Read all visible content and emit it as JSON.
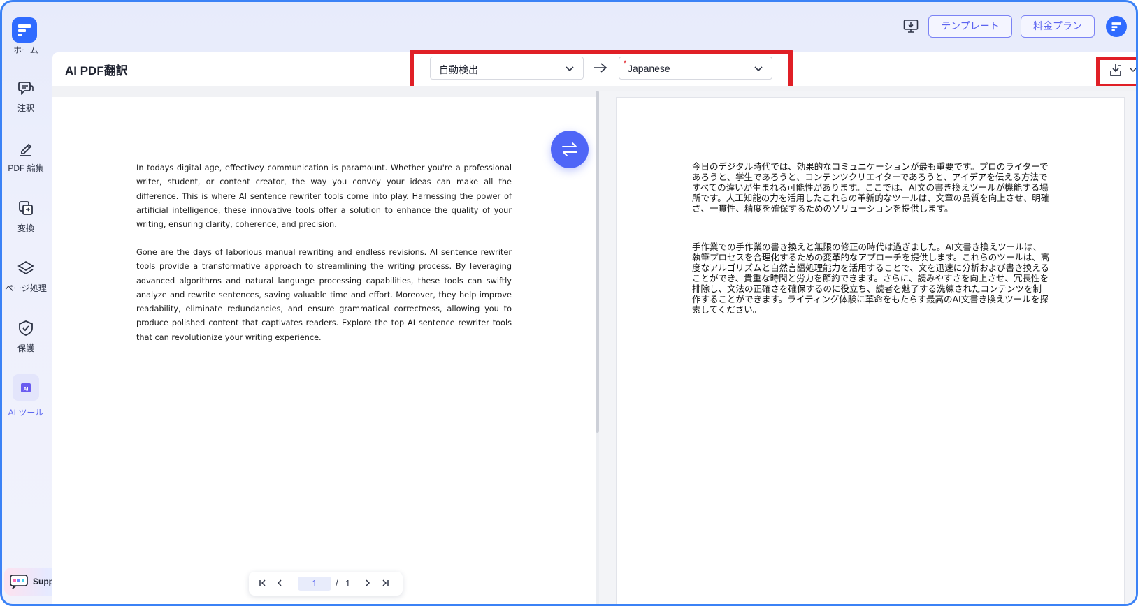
{
  "sidebar": {
    "home_label": "ホーム",
    "items": [
      {
        "label": "注釈",
        "icon": "annotate-icon"
      },
      {
        "label": "PDF 編集",
        "icon": "edit-pen-icon"
      },
      {
        "label": "変換",
        "icon": "convert-icon"
      },
      {
        "label": "ページ処理",
        "icon": "layers-icon"
      },
      {
        "label": "保護",
        "icon": "shield-check-icon"
      },
      {
        "label": "AI ツール",
        "icon": "ai-tool-icon",
        "active": true
      }
    ],
    "support_label": "Support"
  },
  "topbar": {
    "template_label": "テンプレート",
    "pricing_label": "料金プラン"
  },
  "main": {
    "title": "AI PDF翻訳",
    "source_language": "自動検出",
    "target_language": "Japanese",
    "target_required_mark": "*"
  },
  "document": {
    "source_paragraphs": [
      "In todays digital age, effectivey communication  is paramount. Whether you're a professional writer, student, or content creator, the way you convey your ideas can make all the difference. This is where AI sentence rewriter tools come into play. Harnessing the power of artificial intelligence, these innovative tools offer a solution to enhance the quality of your writing, ensuring clarity, coherence, and precision.",
      "Gone are the days of laborious manual rewriting and endless revisions. AI sentence rewriter tools provide a transformative approach to streamlining the writing process. By leveraging advanced algorithms and natural language processing capabilities, these tools can swiftly analyze and rewrite sentences, saving valuable time and effort. Moreover, they help improve readability, eliminate redundancies, and ensure grammatical correctness, allowing you to produce polished content that captivates readers. Explore the top AI sentence rewriter tools that can revolutionize your writing experience."
    ],
    "translated_paragraphs": [
      "今日のデジタル時代では、効果的なコミュニケーションが最も重要です。プロのライターであろうと、学生であろうと、コンテンツクリエイターであろうと、アイデアを伝える方法ですべての違いが生まれる可能性があります。ここでは、AI文の書き換えツールが機能する場所です。人工知能の力を活用したこれらの革新的なツールは、文章の品質を向上させ、明確さ、一貫性、精度を確保するためのソリューションを提供します。",
      "手作業での手作業の書き換えと無限の修正の時代は過ぎました。AI文書き換えツールは、執筆プロセスを合理化するための変革的なアプローチを提供します。これらのツールは、高度なアルゴリズムと自然言語処理能力を活用することで、文を迅速に分析および書き換えることができ、貴重な時間と労力を節約できます。さらに、読みやすさを向上させ、冗長性を排除し、文法の正確さを確保するのに役立ち、読者を魅了する洗練されたコンテンツを制作することができます。ライティング体験に革命をもたらす最高のAI文書き換えツールを探索してください。"
    ]
  },
  "pager": {
    "current_page": "1",
    "separator": "/",
    "total_pages": "1"
  },
  "colors": {
    "accent": "#4f66f7",
    "highlight_red": "#e01f26",
    "brand_blue": "#2f6bff"
  }
}
